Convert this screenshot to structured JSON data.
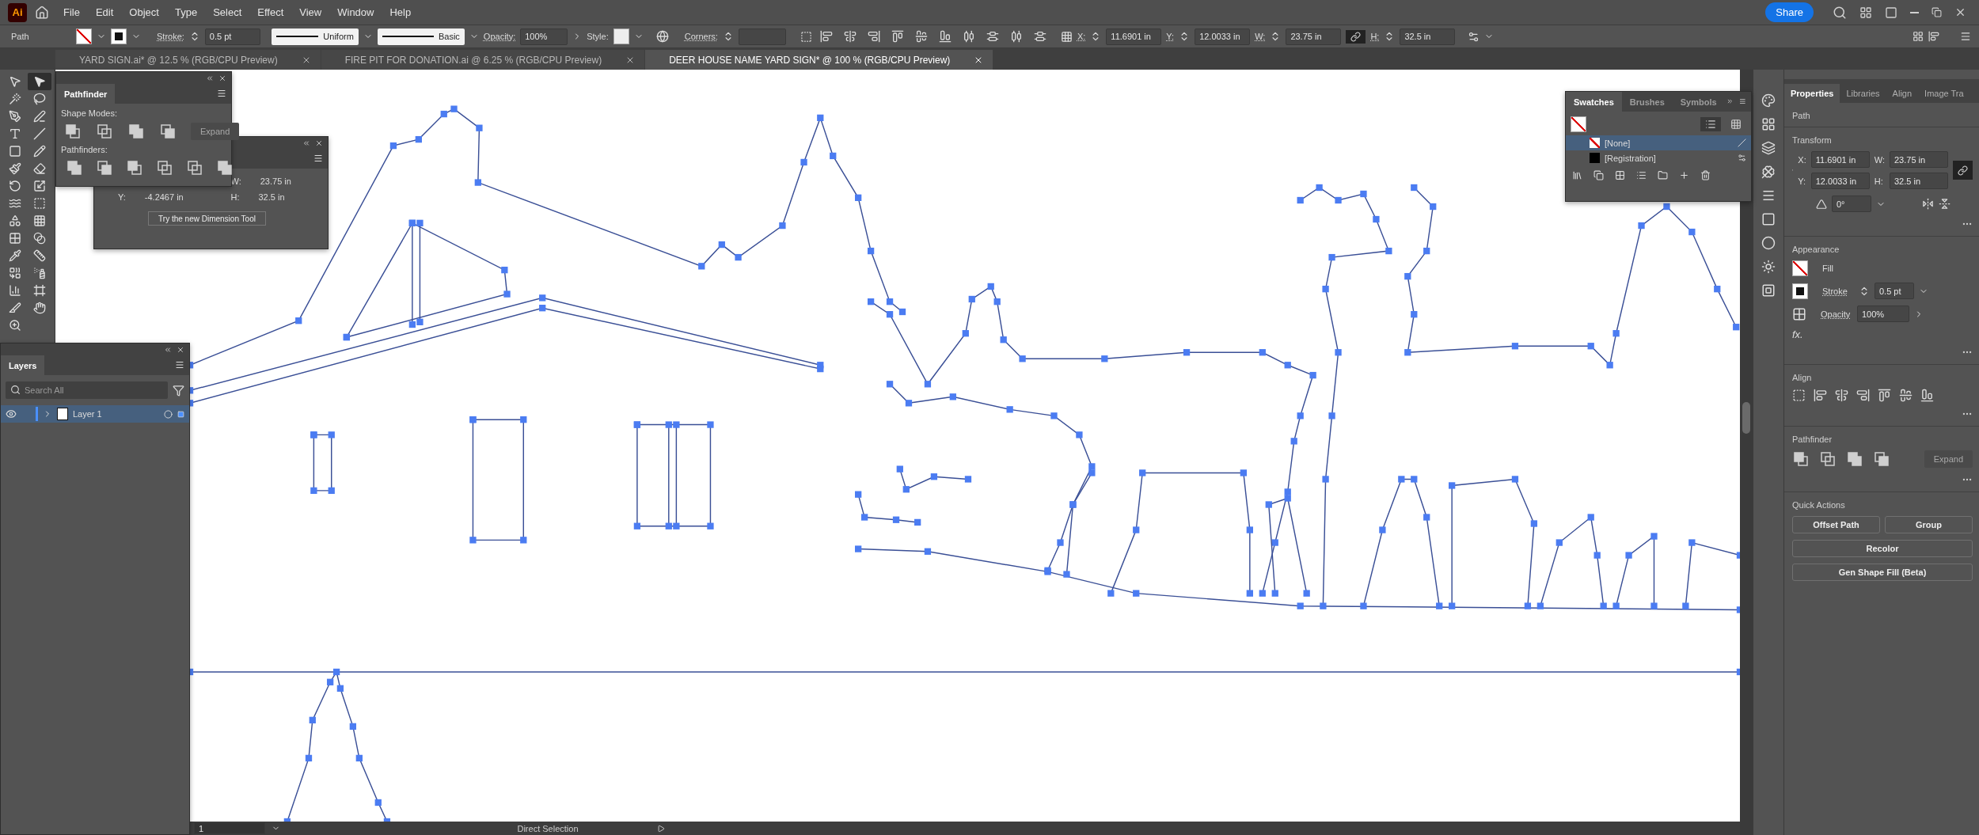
{
  "app_logo": "Ai",
  "menu": [
    "File",
    "Edit",
    "Object",
    "Type",
    "Select",
    "Effect",
    "View",
    "Window",
    "Help"
  ],
  "share_button": "Share",
  "control_bar": {
    "selection_type": "Path",
    "stroke_label": "Stroke:",
    "stroke_weight": "0.5 pt",
    "variable_width": "Uniform",
    "brush": "Basic",
    "opacity_label": "Opacity:",
    "opacity": "100%",
    "style_label": "Style:",
    "corners_label": "Corners:",
    "x_label": "X:",
    "x": "11.6901 in",
    "y_label": "Y:",
    "y": "12.0033 in",
    "w_label": "W:",
    "w": "23.75 in",
    "h_label": "H:",
    "h": "32.5 in"
  },
  "document_tabs": [
    {
      "title": "YARD SIGN.ai* @ 12.5 % (RGB/CPU Preview)",
      "selected": false
    },
    {
      "title": "FIRE PIT FOR DONATION.ai @ 6.25 % (RGB/CPU Preview)",
      "selected": false
    },
    {
      "title": "DEER HOUSE NAME YARD SIGN* @ 100 % (RGB/CPU Preview)",
      "selected": true
    }
  ],
  "tools": [
    {
      "kind": "selection",
      "selected": false
    },
    {
      "kind": "direct",
      "selected": true
    },
    {
      "kind": "wand",
      "selected": false
    },
    {
      "kind": "lasso",
      "selected": false
    },
    {
      "kind": "pen",
      "selected": false
    },
    {
      "kind": "curvature",
      "selected": false
    },
    {
      "kind": "type",
      "selected": false
    },
    {
      "kind": "line",
      "selected": false
    },
    {
      "kind": "rect",
      "selected": false
    },
    {
      "kind": "shaper",
      "selected": false
    },
    {
      "kind": "blob",
      "selected": false
    },
    {
      "kind": "eraser",
      "selected": false
    },
    {
      "kind": "rotate",
      "selected": false
    },
    {
      "kind": "scale",
      "selected": false
    },
    {
      "kind": "warp",
      "selected": false
    },
    {
      "kind": "freetransform",
      "selected": false
    },
    {
      "kind": "shapebuilder",
      "selected": false
    },
    {
      "kind": "perspective",
      "selected": false
    },
    {
      "kind": "mesh",
      "selected": false
    },
    {
      "kind": "gradient",
      "selected": false
    },
    {
      "kind": "eyedropper",
      "selected": false
    },
    {
      "kind": "pipette",
      "selected": false
    },
    {
      "kind": "blend",
      "selected": false
    },
    {
      "kind": "spray",
      "selected": false
    },
    {
      "kind": "graph",
      "selected": false
    },
    {
      "kind": "artboard",
      "selected": false
    },
    {
      "kind": "knife",
      "selected": false
    },
    {
      "kind": "hand",
      "selected": false
    },
    {
      "kind": "zoom",
      "selected": false
    }
  ],
  "pathfinder_panel": {
    "title": "Pathfinder",
    "shape_modes_label": "Shape Modes:",
    "expand_button": {
      "label": "Expand",
      "disabled": true
    },
    "pathfinders_label": "Pathfinders:"
  },
  "transform_panel": {
    "w_label": "W:",
    "w": "23.75 in",
    "y_label": "Y:",
    "y": "-4.2467 in",
    "h_label": "H:",
    "h": "32.5 in",
    "dimension_button": "Try the new Dimension Tool"
  },
  "layers_panel": {
    "title": "Layers",
    "search_placeholder": "Search All",
    "layers": [
      {
        "name": "Layer 1",
        "selected": true,
        "visible": true,
        "expanded": false
      }
    ]
  },
  "swatches_panel": {
    "tabs": [
      {
        "label": "Swatches",
        "selected": true
      },
      {
        "label": "Brushes",
        "selected": false
      },
      {
        "label": "Symbols",
        "selected": false
      }
    ],
    "swatches": [
      {
        "name": "[None]",
        "kind": "none",
        "selected": true
      },
      {
        "name": "[Registration]",
        "kind": "registration",
        "selected": false
      }
    ]
  },
  "properties_panel": {
    "tabs": [
      {
        "label": "Properties",
        "selected": true
      },
      {
        "label": "Libraries",
        "selected": false
      },
      {
        "label": "Align",
        "selected": false
      },
      {
        "label": "Image Tra",
        "selected": false
      }
    ],
    "object_type": "Path",
    "transform_title": "Transform",
    "x_label": "X:",
    "x": "11.6901 in",
    "y_label": "Y:",
    "y": "12.0033 in",
    "w_label": "W:",
    "w": "23.75 in",
    "h_label": "H:",
    "h": "32.5 in",
    "angle": "0°",
    "appearance_title": "Appearance",
    "fill_label": "Fill",
    "stroke_label": "Stroke",
    "stroke_weight": "0.5 pt",
    "opacity_label": "Opacity",
    "opacity": "100%",
    "fx": "fx.",
    "align_title": "Align",
    "pathfinder_title": "Pathfinder",
    "expand_button": {
      "label": "Expand",
      "disabled": true
    },
    "quick_actions_title": "Quick Actions",
    "quick_actions": [
      "Offset Path",
      "Group",
      "Recolor",
      "Gen Shape Fill (Beta)"
    ]
  },
  "status_bar": {
    "artboard": "1",
    "tool": "Direct Selection"
  }
}
